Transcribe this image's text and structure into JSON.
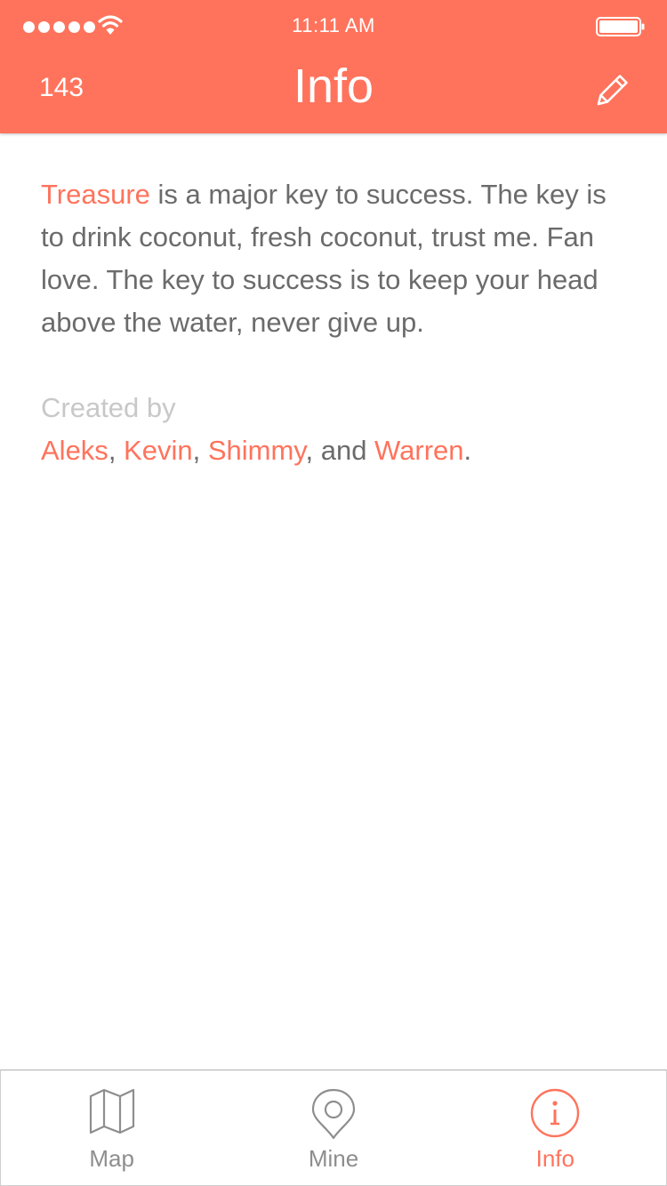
{
  "status_bar": {
    "time": "11:11 AM",
    "signal_icon": "signal-dots-icon",
    "wifi_icon": "wifi-icon",
    "battery_icon": "battery-icon"
  },
  "nav": {
    "count": "143",
    "title": "Info",
    "edit_icon": "pencil-icon"
  },
  "intro": {
    "highlight": "Treasure",
    "text": " is a major key to success. The key is to drink coconut, fresh coconut, trust me. Fan love. The key to success is to keep your head above the water, never give up."
  },
  "credits": {
    "label": "Created by",
    "names": [
      "Aleks",
      "Kevin",
      "Shimmy",
      "Warren"
    ],
    "sep1": ", ",
    "sep2": ", ",
    "sep3": ", and ",
    "end": "."
  },
  "tabs": [
    {
      "label": "Map",
      "icon": "map-icon",
      "active": false
    },
    {
      "label": "Mine",
      "icon": "location-pin-icon",
      "active": false
    },
    {
      "label": "Info",
      "icon": "info-icon",
      "active": true
    }
  ],
  "colors": {
    "accent": "#ff735c",
    "body_text": "#6b6b6b",
    "muted_text": "#c8c8c8",
    "tab_inactive": "#8e8e8e"
  }
}
